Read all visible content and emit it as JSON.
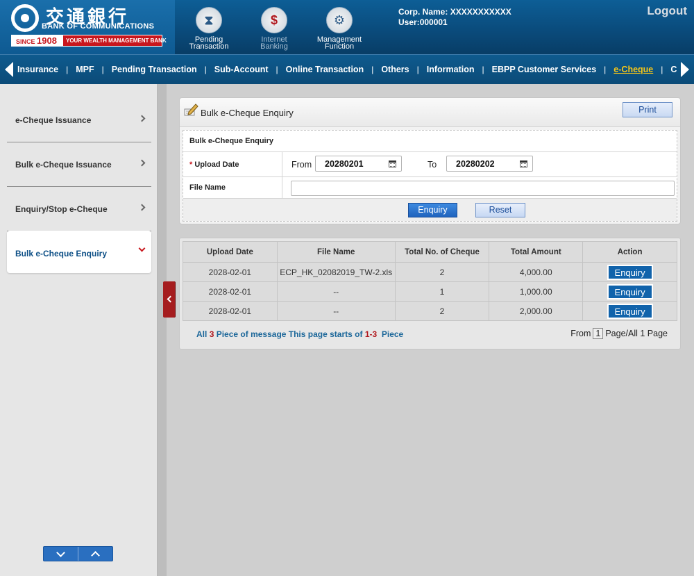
{
  "brand": {
    "name_cn": "交通銀行",
    "name_en": "BANK OF COMMUNICATIONS",
    "since_label": "SINCE",
    "since_year": "1908",
    "tagline": "YOUR WEALTH MANAGEMENT BANK"
  },
  "quick_actions": [
    {
      "label_line1": "Pending",
      "label_line2": "Transaction",
      "icon": "hourglass-icon"
    },
    {
      "label_line1": "Internet",
      "label_line2": "Banking",
      "icon": "monitor-dollar-icon"
    },
    {
      "label_line1": "Management",
      "label_line2": "Function",
      "icon": "gears-icon"
    }
  ],
  "user": {
    "corp_label": "Corp. Name:",
    "corp_value": "XXXXXXXXXXX",
    "user_label": "User:",
    "user_value": "000001"
  },
  "logout_label": "Logout",
  "menu": [
    "Insurance",
    "MPF",
    "Pending Transaction",
    "Sub-Account",
    "Online Transaction",
    "Others",
    "Information",
    "EBPP Customer Services",
    "e-Cheque",
    "Cor"
  ],
  "menu_active_index": 8,
  "sidebar": {
    "items": [
      "e-Cheque Issuance",
      "Bulk e-Cheque Issuance",
      "Enquiry/Stop e-Cheque",
      "Bulk e-Cheque Enquiry"
    ],
    "active_index": 3
  },
  "panel": {
    "title": "Bulk e-Cheque Enquiry",
    "print_label": "Print",
    "form_title": "Bulk e-Cheque Enquiry",
    "required_mark": "*",
    "upload_date_label": "Upload Date",
    "from_label": "From",
    "from_value": "20280201",
    "to_label": "To",
    "to_value": "20280202",
    "file_name_label": "File Name",
    "file_name_value": "",
    "enquiry_label": "Enquiry",
    "reset_label": "Reset"
  },
  "results": {
    "columns": [
      "Upload Date",
      "File Name",
      "Total No. of Cheque",
      "Total Amount",
      "Action"
    ],
    "rows": [
      {
        "upload_date": "2028-02-01",
        "file_name": "ECP_HK_02082019_TW-2.xls",
        "count": "2",
        "amount": "4,000.00",
        "action": "Enquiry"
      },
      {
        "upload_date": "2028-02-01",
        "file_name": "--",
        "count": "1",
        "amount": "1,000.00",
        "action": "Enquiry"
      },
      {
        "upload_date": "2028-02-01",
        "file_name": "--",
        "count": "2",
        "amount": "2,000.00",
        "action": "Enquiry"
      }
    ],
    "summary": {
      "prefix": "All",
      "total": "3",
      "mid": "Piece of message This page starts of",
      "range_start": "1",
      "dash": "-",
      "range_end": "3",
      "suffix": "Piece"
    },
    "pager": {
      "from_label": "From",
      "page": "1",
      "suffix": "Page/All 1 Page"
    }
  },
  "colors": {
    "brand_blue": "#0b4b78",
    "accent_red": "#c8161d",
    "active_menu": "#f5c518",
    "button_blue": "#1163ab"
  }
}
